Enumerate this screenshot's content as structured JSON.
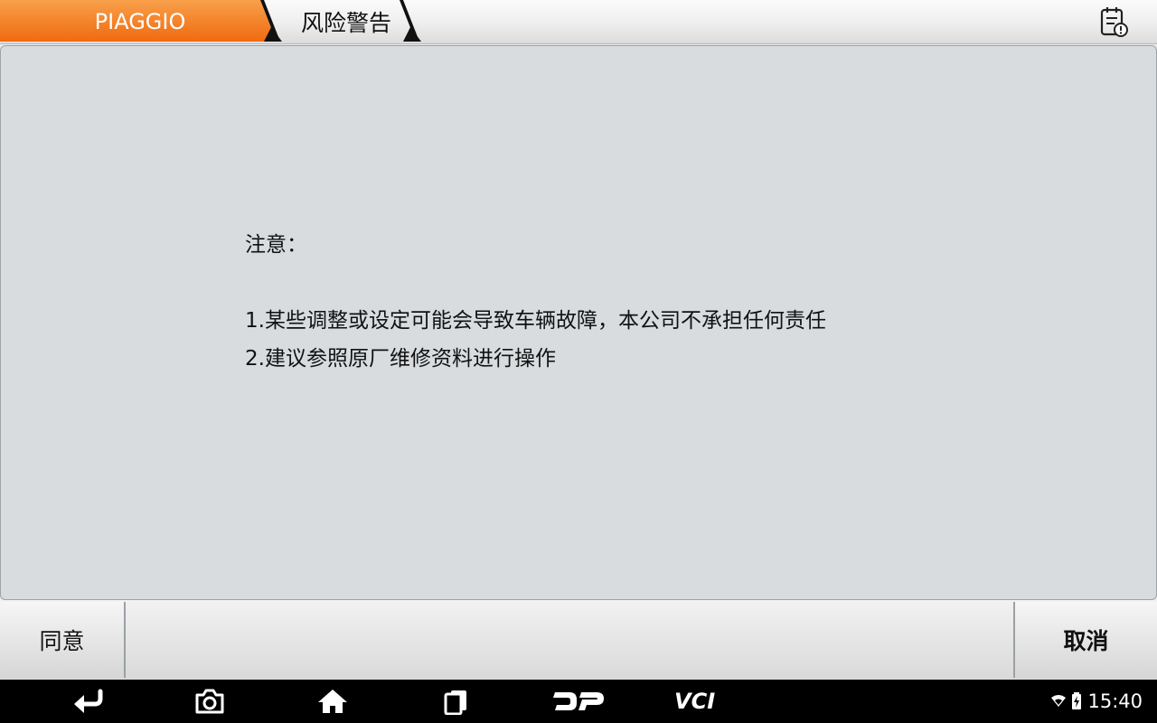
{
  "header": {
    "brand": "PIAGGIO",
    "page_title": "风险警告",
    "brand_color": "#f47a1f"
  },
  "notice": {
    "heading": "注意：",
    "lines": [
      "1.某些调整或设定可能会导致车辆故障，本公司不承担任何责任",
      "2.建议参照原厂维修资料进行操作"
    ]
  },
  "buttons": {
    "agree": "同意",
    "cancel": "取消"
  },
  "navbar": {
    "icons": [
      "back-icon",
      "camera-icon",
      "home-icon",
      "recent-apps-icon",
      "dp-logo-icon",
      "vci-icon"
    ],
    "vci_label": "VCI",
    "time": "15:40"
  }
}
